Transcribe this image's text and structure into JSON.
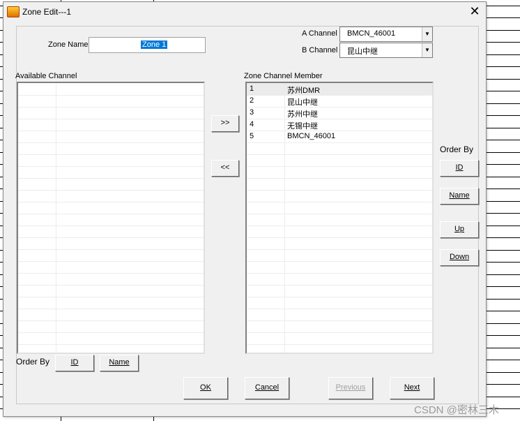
{
  "window": {
    "title": "Zone Edit---1",
    "close_glyph": "✕"
  },
  "zone_name": {
    "label": "Zone Name",
    "value": "Zone 1"
  },
  "a_channel": {
    "label": "A Channel",
    "value": "BMCN_46001"
  },
  "b_channel": {
    "label": "B Channel",
    "value": "昆山中继"
  },
  "available": {
    "label": "Available Channel"
  },
  "member": {
    "label": "Zone Channel Member",
    "rows": [
      {
        "id": "1",
        "name": "苏州DMR"
      },
      {
        "id": "2",
        "name": "昆山中继"
      },
      {
        "id": "3",
        "name": "苏州中继"
      },
      {
        "id": "4",
        "name": "无锡中继"
      },
      {
        "id": "5",
        "name": "BMCN_46001"
      }
    ]
  },
  "transfer": {
    "add": ">>",
    "remove": "<<"
  },
  "order_right": {
    "label": "Order By",
    "id": "ID",
    "name": "Name",
    "up": "Up",
    "down": "Down"
  },
  "order_left": {
    "label": "Order By",
    "id": "ID",
    "name": "Name"
  },
  "footer": {
    "ok": "OK",
    "cancel": "Cancel",
    "previous": "Previous",
    "next": "Next"
  },
  "watermark": "CSDN @密林三木"
}
